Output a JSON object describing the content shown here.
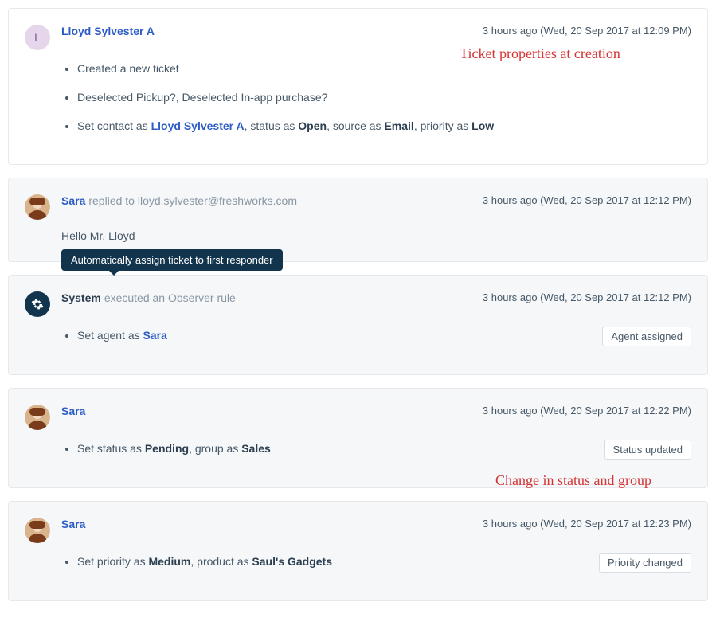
{
  "events": [
    {
      "actor": "Lloyd Sylvester A",
      "avatar_initial": "L",
      "timestamp": "3 hours ago (Wed, 20 Sep 2017 at 12:09 PM)",
      "items": {
        "i1": "Created a new ticket",
        "i2": "Deselected Pickup?, Deselected In-app purchase?",
        "i3_pre": "Set contact as ",
        "i3_link": "Lloyd Sylvester A",
        "i3_mid1": ", status as ",
        "i3_b1": "Open",
        "i3_mid2": ", source as ",
        "i3_b2": "Email",
        "i3_mid3": ", priority as ",
        "i3_b3": "Low"
      },
      "annotation": "Ticket properties at creation"
    },
    {
      "actor": "Sara",
      "action_text": " replied to  lloyd.sylvester@freshworks.com",
      "timestamp": "3 hours ago (Wed, 20 Sep 2017 at 12:12 PM)",
      "body": "Hello Mr. Lloyd"
    },
    {
      "actor": "System",
      "action_text": " executed an Observer rule",
      "timestamp": "3 hours ago (Wed, 20 Sep 2017 at 12:12 PM)",
      "tooltip": "Automatically assign ticket to first responder",
      "items": {
        "i1_pre": "Set agent as ",
        "i1_link": "Sara"
      },
      "badge": "Agent assigned"
    },
    {
      "actor": "Sara",
      "timestamp": "3 hours ago (Wed, 20 Sep 2017 at 12:22 PM)",
      "items": {
        "i1_pre": "Set status as ",
        "i1_b1": "Pending",
        "i1_mid": ", group as ",
        "i1_b2": "Sales"
      },
      "badge": "Status updated",
      "annotation": "Change in status and group"
    },
    {
      "actor": "Sara",
      "timestamp": "3 hours ago (Wed, 20 Sep 2017 at 12:23 PM)",
      "items": {
        "i1_pre": "Set priority as ",
        "i1_b1": "Medium",
        "i1_mid": ", product as ",
        "i1_b2": "Saul's Gadgets"
      },
      "badge": "Priority changed"
    }
  ]
}
